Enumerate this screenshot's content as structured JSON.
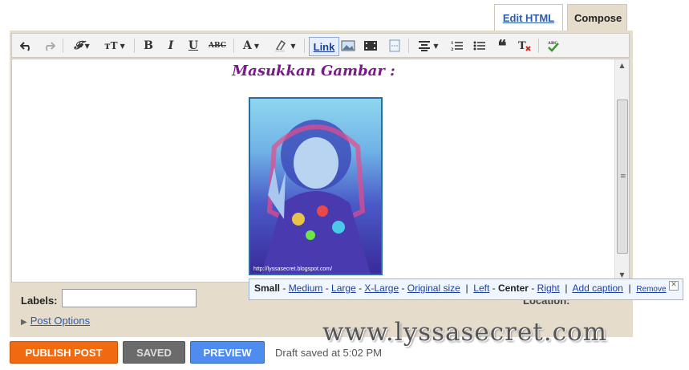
{
  "tabs": {
    "edit_html": "Edit HTML",
    "compose": "Compose"
  },
  "toolbar": {
    "link_label": "Link",
    "icons": [
      "undo-icon",
      "redo-icon",
      "font-family-icon",
      "font-size-icon",
      "bold-icon",
      "italic-icon",
      "underline-icon",
      "strikethrough-icon",
      "text-color-icon",
      "highlight-icon",
      "link",
      "image-icon",
      "video-icon",
      "jump-break-icon",
      "align-icon",
      "numbered-list-icon",
      "bullet-list-icon",
      "quote-icon",
      "remove-formatting-icon",
      "spellcheck-icon"
    ]
  },
  "editor": {
    "heading": "Masukkan Gambar :",
    "image_caption": "http://lyssasecret.blogspot.com/"
  },
  "image_popup": {
    "small": "Small",
    "medium": "Medium",
    "large": "Large",
    "xlarge": "X-Large",
    "original": "Original size",
    "left": "Left",
    "center": "Center",
    "right": "Right",
    "add_caption": "Add caption",
    "remove": "Remove"
  },
  "labels_section": {
    "label": "Labels:",
    "value": "",
    "location_label": "Location:"
  },
  "post_options": "Post Options",
  "watermark": "www.lyssasecret.com",
  "buttons": {
    "publish": "PUBLISH POST",
    "saved": "SAVED",
    "preview": "PREVIEW"
  },
  "status": "Draft saved at 5:02 PM",
  "colors": {
    "frame": "#e5dccb",
    "publish": "#f26a10",
    "preview": "#4f8cf0",
    "heading": "#7a1a8a",
    "link": "#2a5db0"
  }
}
